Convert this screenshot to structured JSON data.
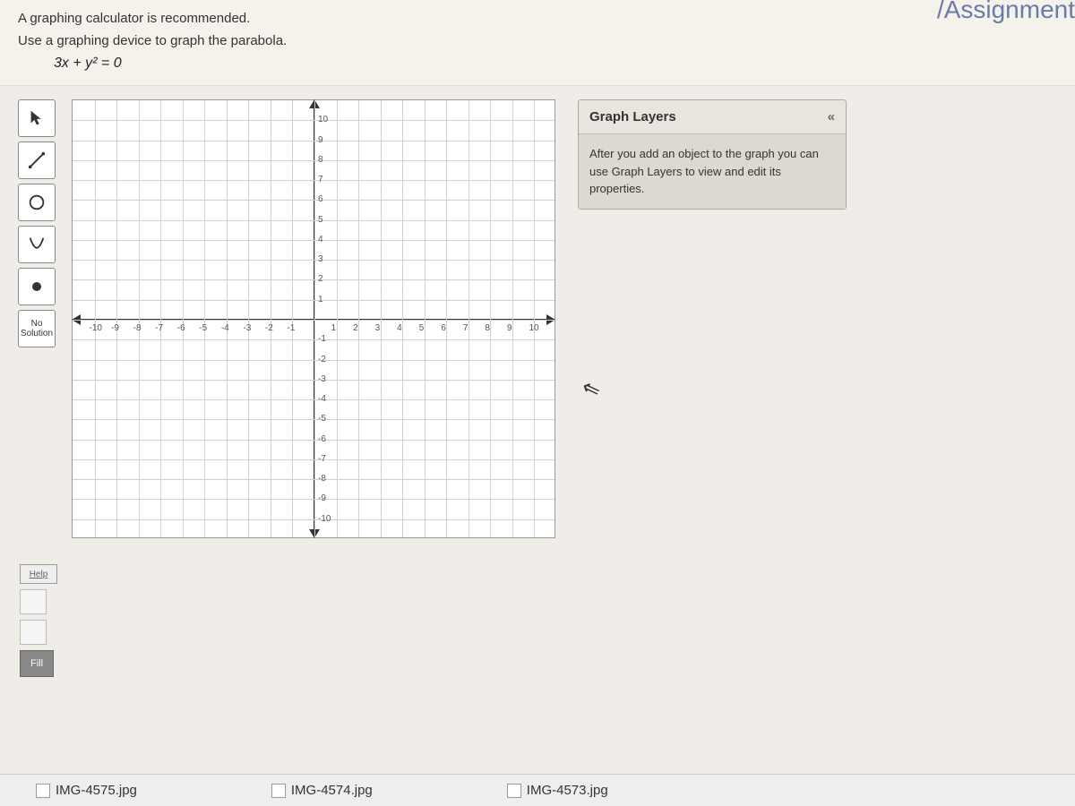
{
  "header_partial": "/Assignment",
  "instructions": {
    "line1": "A graphing calculator is recommended.",
    "line2": "Use a graphing device to graph the parabola.",
    "formula": "3x + y² = 0"
  },
  "toolbar": {
    "no_solution": "No\nSolution",
    "help": "Help",
    "fill": "Fill"
  },
  "graph": {
    "x_ticks": [
      "-10",
      "-9",
      "-8",
      "-7",
      "-6",
      "-5",
      "-4",
      "-3",
      "-2",
      "-1",
      "1",
      "2",
      "3",
      "4",
      "5",
      "6",
      "7",
      "8",
      "9",
      "10"
    ],
    "y_ticks_pos": [
      "1",
      "2",
      "3",
      "4",
      "5",
      "6",
      "7",
      "8",
      "9",
      "10"
    ],
    "y_ticks_neg": [
      "-1",
      "-2",
      "-3",
      "-4",
      "-5",
      "-6",
      "-7",
      "-8",
      "-9",
      "-10"
    ]
  },
  "layers": {
    "title": "Graph Layers",
    "collapse": "«",
    "body": "After you add an object to the graph you can use Graph Layers to view and edit its properties."
  },
  "taskbar": {
    "file1": "IMG-4575.jpg",
    "file2": "IMG-4574.jpg",
    "file3": "IMG-4573.jpg"
  },
  "chart_data": {
    "type": "scatter",
    "title": "",
    "xlabel": "",
    "ylabel": "",
    "xlim": [
      -10,
      10
    ],
    "ylim": [
      -10,
      10
    ],
    "grid": true,
    "series": []
  }
}
